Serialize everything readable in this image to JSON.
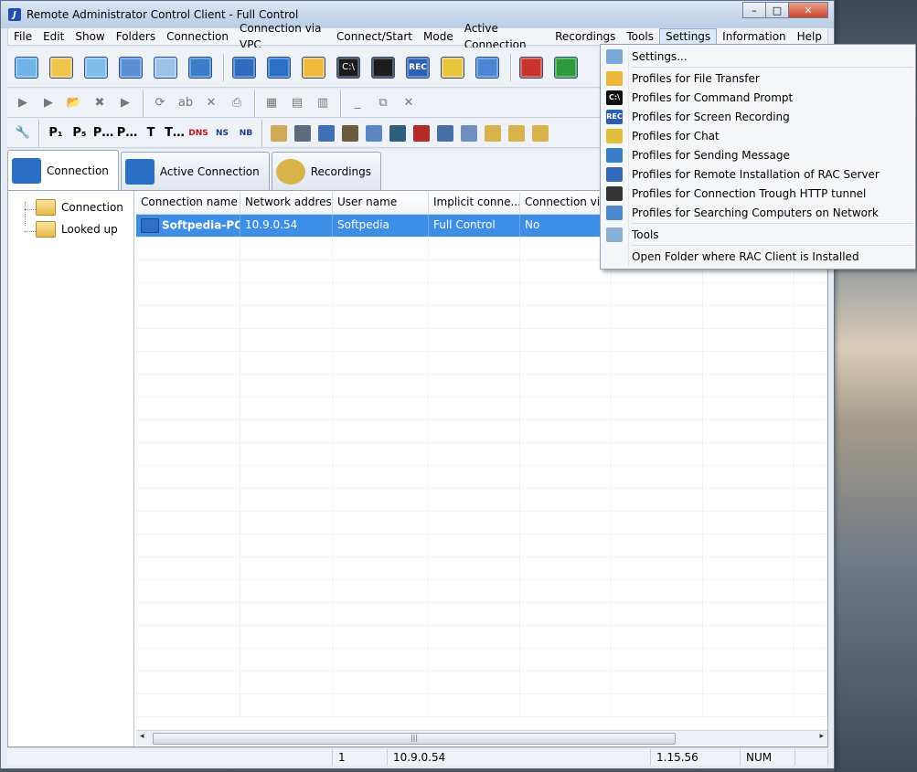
{
  "window": {
    "title": "Remote Administrator Control Client - Full Control",
    "app_icon_letter": "J",
    "controls": {
      "minimize": "–",
      "maximize": "□",
      "close": "✕"
    }
  },
  "menubar": {
    "items": [
      "File",
      "Edit",
      "Show",
      "Folders",
      "Connection",
      "Connection via VPC",
      "Connect/Start",
      "Mode",
      "Active Connection",
      "Recordings",
      "Tools",
      "Settings",
      "Information",
      "Help"
    ],
    "active": "Settings"
  },
  "toolbar1": {
    "icons": [
      "new-connection-icon",
      "edit-connection-icon",
      "find-connection-icon",
      "search-network-icon",
      "properties-icon",
      "settings-icon",
      "full-control-icon",
      "view-only-icon",
      "file-transfer-icon",
      "command-prompt-icon",
      "monitor-icon",
      "screen-recording-icon",
      "chat-icon",
      "send-message-icon",
      "shutdown-icon",
      "power-on-icon"
    ],
    "colors": [
      "#6fb3e8",
      "#f1c44a",
      "#7fbde9",
      "#5b8fd4",
      "#9bc3ea",
      "#3a7ec9",
      "#2f6cc0",
      "#2b6fc7",
      "#f1b93c",
      "#1b1b1b",
      "#1d1d1d",
      "#2a5fb3",
      "#e9c43a",
      "#4a86d2",
      "#c8342a",
      "#2e9b3a"
    ],
    "command_prompt_label": "C:\\",
    "rec_label": "REC"
  },
  "toolbar2": {
    "icons": [
      "play-icon",
      "play-alt-icon",
      "open-folder-icon",
      "delete-icon",
      "step-icon",
      "refresh-icon",
      "rename-icon",
      "cut-icon",
      "print-icon",
      "grid-icon",
      "columns-icon",
      "rows-icon",
      "minimize-icon",
      "restore-icon",
      "close-x-icon"
    ],
    "glyphs": [
      "▶",
      "▶",
      "📂",
      "✖",
      "▶",
      "⟳",
      "ab",
      "✕",
      "⎙",
      "▦",
      "▤",
      "▥",
      "_",
      "⧉",
      "✕"
    ]
  },
  "toolbar3": {
    "items": [
      "wrench-icon",
      "P1",
      "P5",
      "P…",
      "P…",
      "T",
      "T…",
      "DNS IP",
      "NS look",
      "NB stat"
    ],
    "labels": [
      "🔧",
      "P₁",
      "P₅",
      "P…",
      "P…",
      "T",
      "T…",
      "DNS",
      "NS",
      "NB"
    ],
    "extra_icons": [
      "calculator-icon",
      "gears-icon",
      "computer-icon",
      "people-icon",
      "network-icon",
      "terminal-icon",
      "clock-icon",
      "tree-icon",
      "cube-icon",
      "disk-c-icon",
      "disk-d-icon",
      "disk-e-icon"
    ]
  },
  "tabs": [
    {
      "label": "Connection",
      "selected": true
    },
    {
      "label": "Active Connection",
      "selected": false
    },
    {
      "label": "Recordings",
      "selected": false
    }
  ],
  "tree": {
    "items": [
      "Connection",
      "Looked up"
    ]
  },
  "grid": {
    "columns": [
      "Connection name",
      "Network address",
      "User name",
      "Implicit conne...",
      "Connection vi...",
      "",
      "",
      ""
    ],
    "rows": [
      [
        "Softpedia-PC",
        "10.9.0.54",
        "Softpedia",
        "Full Control",
        "No",
        "",
        "",
        ""
      ]
    ]
  },
  "scroll": {
    "thumb_grip": "|||",
    "left_arrow": "◂",
    "right_arrow": "▸"
  },
  "statusbar": {
    "cells": [
      "",
      "1",
      "10.9.0.54",
      "",
      "1.15.56",
      "NUM",
      ""
    ]
  },
  "settings_menu": {
    "items": [
      {
        "label": "Settings...",
        "icon": "gear-icon",
        "color": "#7aa7d8"
      },
      {
        "sep": true
      },
      {
        "label": "Profiles for File Transfer",
        "icon": "folder-icon",
        "color": "#efb83c"
      },
      {
        "label": "Profiles for Command Prompt",
        "icon": "command-prompt-icon",
        "color": "#111111",
        "glyph": "C:\\"
      },
      {
        "label": "Profiles for Screen Recording",
        "icon": "screen-recording-icon",
        "color": "#2a5fb3",
        "glyph": "REC"
      },
      {
        "label": "Profiles for Chat",
        "icon": "chat-icon",
        "color": "#e2be3a"
      },
      {
        "label": "Profiles for Sending Message",
        "icon": "send-message-icon",
        "color": "#3a7ec9"
      },
      {
        "label": "Profiles for Remote Installation of RAC Server",
        "icon": "remote-install-icon",
        "color": "#3468b8"
      },
      {
        "label": "Profiles for Connection Trough HTTP tunnel",
        "icon": "http-tunnel-icon",
        "color": "#333333"
      },
      {
        "label": "Profiles for Searching Computers on Network",
        "icon": "search-network-icon",
        "color": "#4d88cf"
      },
      {
        "sep": true
      },
      {
        "label": "Tools",
        "icon": "tools-icon",
        "color": "#8ab0d6"
      },
      {
        "sep": true
      },
      {
        "label": "Open Folder where RAC Client is Installed",
        "icon": "",
        "color": ""
      }
    ]
  }
}
